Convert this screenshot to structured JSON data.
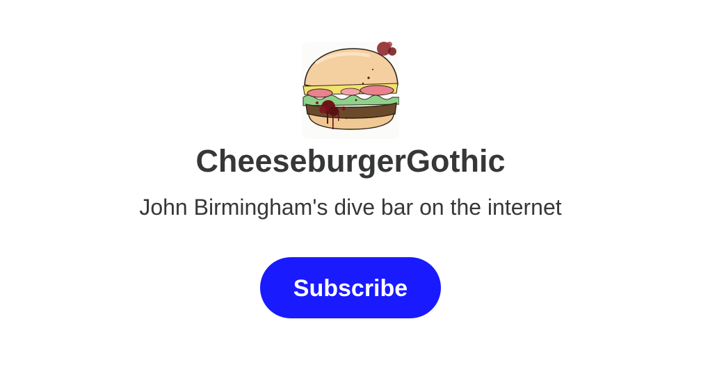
{
  "publication": {
    "name": "CheeseburgerGothic",
    "tagline": "John Birmingham's dive bar on the internet",
    "logo_icon": "cheeseburger-logo-icon"
  },
  "actions": {
    "subscribe_label": "Subscribe"
  },
  "colors": {
    "background": "#ffffff",
    "text": "#363737",
    "accent": "#1a1aff",
    "button_text": "#ffffff"
  }
}
